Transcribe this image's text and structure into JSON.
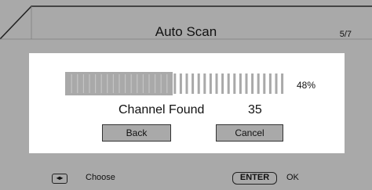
{
  "dialog": {
    "title": "Auto Scan",
    "page_indicator": "5/7"
  },
  "scan": {
    "progress": 0.48,
    "percent_text": "48%",
    "found_label": "Channel Found",
    "found_count": "35"
  },
  "buttons": {
    "back_label": "Back",
    "cancel_label": "Cancel"
  },
  "footer": {
    "choose_icon": "◂▸",
    "choose_label": "Choose",
    "enter_key": "ENTER",
    "ok_label": "OK"
  },
  "colors": {
    "frame": "#a9a9a9",
    "panel": "#ffffff",
    "progress_filled": "#a9a9a9",
    "progress_empty_tick": "#a9a9a9"
  }
}
